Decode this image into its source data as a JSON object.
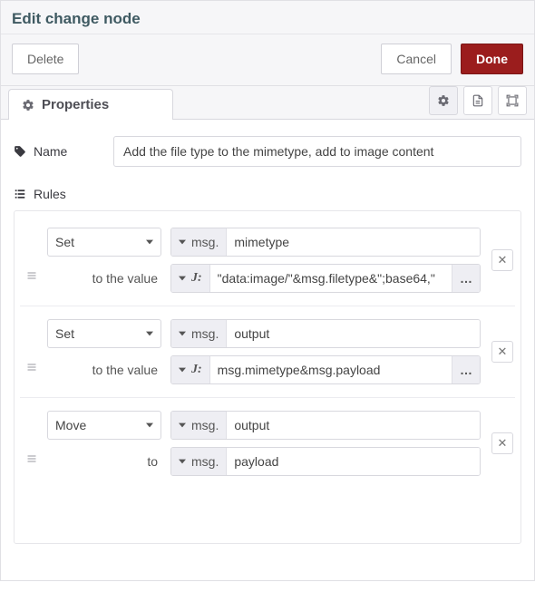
{
  "header": {
    "title": "Edit change node"
  },
  "toolbar": {
    "delete_label": "Delete",
    "cancel_label": "Cancel",
    "done_label": "Done"
  },
  "tabs": {
    "properties_label": "Properties",
    "icons": {
      "gear": "gear",
      "doc": "document",
      "expand": "expand"
    }
  },
  "form": {
    "name_label": "Name",
    "name_value": "Add the file type to the mimetype, add to image content",
    "rules_label": "Rules"
  },
  "rules": [
    {
      "action": "Set",
      "target_type": "msg.",
      "target_field": "mimetype",
      "to_label": "to the value",
      "value_type": "J:",
      "value": "\"data:image/\"&msg.filetype&\";base64,\"",
      "has_expand": true
    },
    {
      "action": "Set",
      "target_type": "msg.",
      "target_field": "output",
      "to_label": "to the value",
      "value_type": "J:",
      "value": "msg.mimetype&msg.payload",
      "has_expand": true
    },
    {
      "action": "Move",
      "target_type": "msg.",
      "target_field": "output",
      "to_label": "to",
      "value_type": "msg.",
      "value": "payload",
      "has_expand": false
    }
  ]
}
